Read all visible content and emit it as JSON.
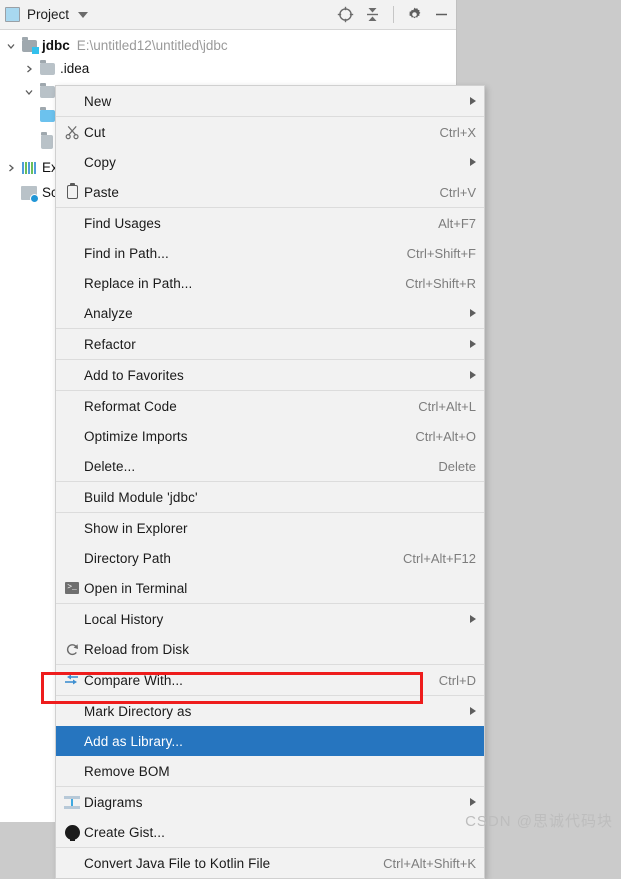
{
  "window": {
    "panel_title": "Project",
    "icons": {
      "window": "project-window-icon",
      "dropdown": "chevron-down-icon",
      "locate": "locate-target-icon",
      "collapse": "collapse-all-icon",
      "settings": "gear-icon",
      "hide": "minimize-icon"
    }
  },
  "tree": [
    {
      "name": "jdbc",
      "path": "E:\\untitled12\\untitled\\jdbc",
      "twisty": "expanded",
      "icon": "module-folder-icon",
      "indent": 0
    },
    {
      "name": ".idea",
      "path": "",
      "twisty": "collapsed",
      "icon": "folder-icon",
      "indent": 1
    },
    {
      "name": "",
      "path": "",
      "twisty": "expanded",
      "icon": "folder-icon",
      "indent": 1
    }
  ],
  "tree_hidden": [
    {
      "icon": "folder-icon",
      "label": ""
    },
    {
      "icon": "file-icon",
      "label": ""
    },
    {
      "icon": "chart-icon",
      "label": "Ex"
    },
    {
      "icon": "scratch-icon",
      "label": "Sc"
    }
  ],
  "menu": {
    "groups": [
      {
        "items": [
          {
            "label": "New",
            "mnemonic": "",
            "shortcut": "",
            "submenu": true,
            "icon": "",
            "selected": false
          }
        ]
      },
      {
        "items": [
          {
            "label": "Cut",
            "mnemonic": "t",
            "shortcut": "Ctrl+X",
            "submenu": false,
            "icon": "scissors-icon",
            "selected": false
          },
          {
            "label": "Copy",
            "mnemonic": "",
            "shortcut": "",
            "submenu": true,
            "icon": "",
            "selected": false
          },
          {
            "label": "Paste",
            "mnemonic": "P",
            "shortcut": "Ctrl+V",
            "submenu": false,
            "icon": "clipboard-icon",
            "selected": false
          }
        ]
      },
      {
        "items": [
          {
            "label": "Find Usages",
            "mnemonic": "U",
            "shortcut": "Alt+F7",
            "submenu": false,
            "icon": "",
            "selected": false
          },
          {
            "label": "Find in Path...",
            "mnemonic": "P",
            "shortcut": "Ctrl+Shift+F",
            "submenu": false,
            "icon": "",
            "selected": false
          },
          {
            "label": "Replace in Path...",
            "mnemonic": "a",
            "shortcut": "Ctrl+Shift+R",
            "submenu": false,
            "icon": "",
            "selected": false
          },
          {
            "label": "Analyze",
            "mnemonic": "z",
            "shortcut": "",
            "submenu": true,
            "icon": "",
            "selected": false
          }
        ]
      },
      {
        "items": [
          {
            "label": "Refactor",
            "mnemonic": "R",
            "shortcut": "",
            "submenu": true,
            "icon": "",
            "selected": false
          }
        ]
      },
      {
        "items": [
          {
            "label": "Add to Favorites",
            "mnemonic": "a",
            "shortcut": "",
            "submenu": true,
            "icon": "",
            "selected": false
          }
        ]
      },
      {
        "items": [
          {
            "label": "Reformat Code",
            "mnemonic": "R",
            "shortcut": "Ctrl+Alt+L",
            "submenu": false,
            "icon": "",
            "selected": false
          },
          {
            "label": "Optimize Imports",
            "mnemonic": "z",
            "shortcut": "Ctrl+Alt+O",
            "submenu": false,
            "icon": "",
            "selected": false
          },
          {
            "label": "Delete...",
            "mnemonic": "D",
            "shortcut": "Delete",
            "submenu": false,
            "icon": "",
            "selected": false
          }
        ]
      },
      {
        "items": [
          {
            "label": "Build Module 'jdbc'",
            "mnemonic": "M",
            "shortcut": "",
            "submenu": false,
            "icon": "",
            "selected": false
          }
        ]
      },
      {
        "items": [
          {
            "label": "Show in Explorer",
            "mnemonic": "",
            "shortcut": "",
            "submenu": false,
            "icon": "",
            "selected": false
          },
          {
            "label": "Directory Path",
            "mnemonic": "P",
            "shortcut": "Ctrl+Alt+F12",
            "submenu": false,
            "icon": "",
            "selected": false
          },
          {
            "label": "Open in Terminal",
            "mnemonic": "",
            "shortcut": "",
            "submenu": false,
            "icon": "terminal-icon",
            "selected": false
          }
        ]
      },
      {
        "items": [
          {
            "label": "Local History",
            "mnemonic": "H",
            "shortcut": "",
            "submenu": true,
            "icon": "",
            "selected": false
          },
          {
            "label": "Reload from Disk",
            "mnemonic": "",
            "shortcut": "",
            "submenu": false,
            "icon": "reload-icon",
            "selected": false
          }
        ]
      },
      {
        "items": [
          {
            "label": "Compare With...",
            "mnemonic": "",
            "shortcut": "Ctrl+D",
            "submenu": false,
            "icon": "compare-icon",
            "selected": false
          }
        ]
      },
      {
        "items": [
          {
            "label": "Mark Directory as",
            "mnemonic": "",
            "shortcut": "",
            "submenu": true,
            "icon": "",
            "selected": false
          },
          {
            "label": "Add as Library...",
            "mnemonic": "",
            "shortcut": "",
            "submenu": false,
            "icon": "",
            "selected": true
          },
          {
            "label": "Remove BOM",
            "mnemonic": "",
            "shortcut": "",
            "submenu": false,
            "icon": "",
            "selected": false
          }
        ]
      },
      {
        "items": [
          {
            "label": "Diagrams",
            "mnemonic": "",
            "shortcut": "",
            "submenu": true,
            "icon": "diagram-icon",
            "selected": false
          },
          {
            "label": "Create Gist...",
            "mnemonic": "",
            "shortcut": "",
            "submenu": false,
            "icon": "github-icon",
            "selected": false
          }
        ]
      },
      {
        "items": [
          {
            "label": "Convert Java File to Kotlin File",
            "mnemonic": "",
            "shortcut": "Ctrl+Alt+Shift+K",
            "submenu": false,
            "icon": "",
            "selected": false
          }
        ]
      }
    ]
  },
  "annotation": {
    "color": "#ee1c1c",
    "target_label": "Add as Library..."
  },
  "watermark": {
    "text": "CSDN @思诚代码块"
  },
  "colors": {
    "selection": "#2675bf",
    "menu_bg": "#f2f2f2",
    "panel_bg": "#ffffff",
    "desktop_bg": "#cbcbcb",
    "annotation": "#ee1c1c"
  }
}
